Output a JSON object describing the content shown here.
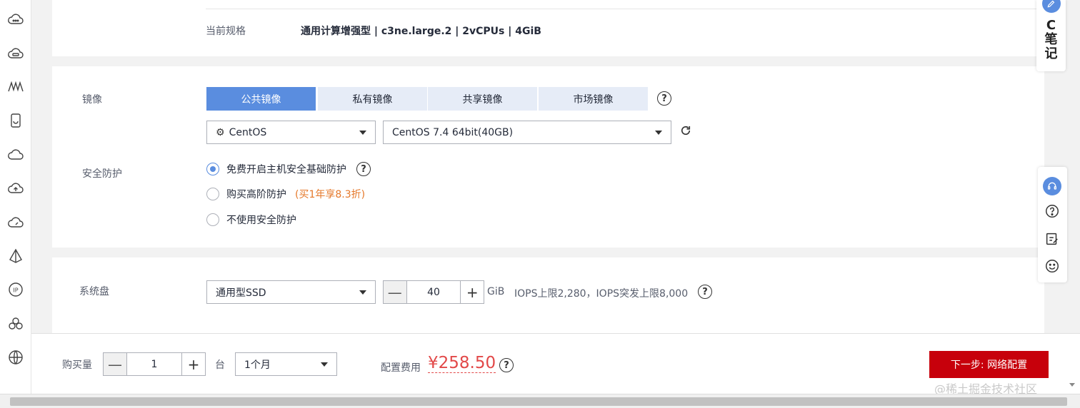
{
  "spec": {
    "label": "当前规格",
    "value": "通用计算增强型 | c3ne.large.2 | 2vCPUs | 4GiB"
  },
  "image": {
    "label": "镜像",
    "tabs": [
      "公共镜像",
      "私有镜像",
      "共享镜像",
      "市场镜像"
    ],
    "os_select": "CentOS",
    "version_select": "CentOS 7.4 64bit(40GB)"
  },
  "security": {
    "label": "安全防护",
    "options": [
      "免费开启主机安全基础防护",
      "购买高阶防护",
      "不使用安全防护"
    ],
    "promo": "(买1年享8.3折)",
    "selected_index": 0
  },
  "disk": {
    "label": "系统盘",
    "type_select": "通用型SSD",
    "size": "40",
    "unit": "GiB",
    "iops": "IOPS上限2,280，IOPS突发上限8,000"
  },
  "bottom": {
    "quantity_label": "购买量",
    "quantity": "1",
    "quantity_unit": "台",
    "duration": "1个月",
    "cost_label": "配置费用",
    "price": "¥258.50",
    "next_button": "下一步: 网络配置"
  },
  "note": {
    "text_line1": "C",
    "text_line2": "笔",
    "text_line3": "记"
  },
  "help_glyph": "?",
  "stepper": {
    "minus": "—",
    "plus": "+"
  },
  "watermark": "@稀土掘金技术社区",
  "colors": {
    "accent": "#5a8ddf",
    "primary_button": "#c7000b",
    "price": "#e24848",
    "promo": "#e5782a"
  }
}
